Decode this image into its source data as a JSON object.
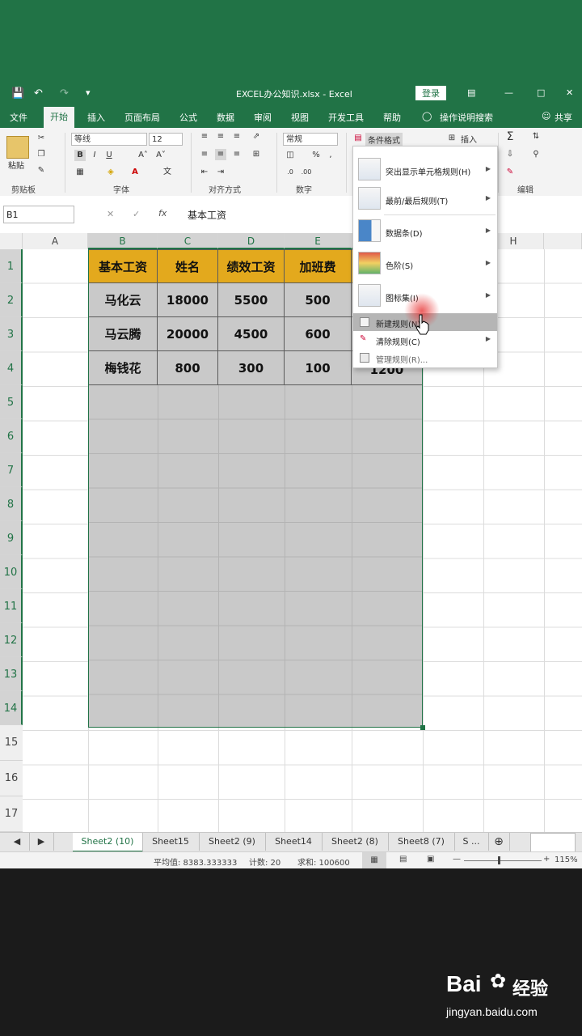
{
  "window": {
    "title": "EXCEL办公知识.xlsx  -  Excel",
    "login_button": "登录"
  },
  "ribbon_tabs": [
    "文件",
    "开始",
    "插入",
    "页面布局",
    "公式",
    "数据",
    "审阅",
    "视图",
    "开发工具",
    "帮助"
  ],
  "ribbon_search": "操作说明搜索",
  "share_label": "共享",
  "ribbon": {
    "paste_label": "粘贴",
    "font_name": "等线",
    "font_size": "12",
    "number_format": "常规",
    "conditional_format_label": "条件格式",
    "insert_label": "插入",
    "groups": {
      "clipboard": "剪贴板",
      "font": "字体",
      "alignment": "对齐方式",
      "number": "数字",
      "editing": "编辑"
    }
  },
  "formula_bar": {
    "name_box": "B1",
    "content": "基本工资"
  },
  "columns": [
    "A",
    "B",
    "C",
    "D",
    "E",
    "H"
  ],
  "rows": [
    "1",
    "2",
    "3",
    "4",
    "5",
    "6",
    "7",
    "8",
    "9",
    "10",
    "11",
    "12",
    "13",
    "14",
    "15",
    "16",
    "17"
  ],
  "table": {
    "headers": [
      "基本工资",
      "姓名",
      "绩效工资",
      "加班费"
    ],
    "rows": [
      [
        "马化云",
        "18000",
        "5500",
        "500"
      ],
      [
        "马云腾",
        "20000",
        "4500",
        "600"
      ],
      [
        "梅钱花",
        "800",
        "300",
        "100"
      ]
    ],
    "f4_partial": "1200"
  },
  "cond_menu": {
    "items": [
      {
        "label": "突出显示单元格规则(H)",
        "icon": "highlight-rules-icon",
        "submenu": true
      },
      {
        "label": "最前/最后规则(T)",
        "icon": "top-bottom-rules-icon",
        "submenu": true
      },
      {
        "label": "数据条(D)",
        "icon": "data-bars-icon",
        "submenu": true
      },
      {
        "label": "色阶(S)",
        "icon": "color-scales-icon",
        "submenu": true
      },
      {
        "label": "图标集(I)",
        "icon": "icon-sets-icon",
        "submenu": true
      }
    ],
    "small_items": [
      {
        "label": "新建规则(N)...",
        "highlighted": true
      },
      {
        "label": "清除规则(C)",
        "submenu": true
      },
      {
        "label": "管理规则(R)..."
      }
    ]
  },
  "sheet_tabs": [
    "Sheet2 (10)",
    "Sheet15",
    "Sheet2 (9)",
    "Sheet14",
    "Sheet2 (8)",
    "Sheet8 (7)",
    "S ..."
  ],
  "status": {
    "average": "平均值: 8383.333333",
    "count": "计数: 20",
    "sum": "求和: 100600",
    "zoom": "115%"
  },
  "watermark": {
    "brand": "Bai",
    "brand2": "经验",
    "url": "jingyan.baidu.com"
  },
  "colors": {
    "excel_green": "#217346",
    "header_fill": "#e3a91d"
  }
}
